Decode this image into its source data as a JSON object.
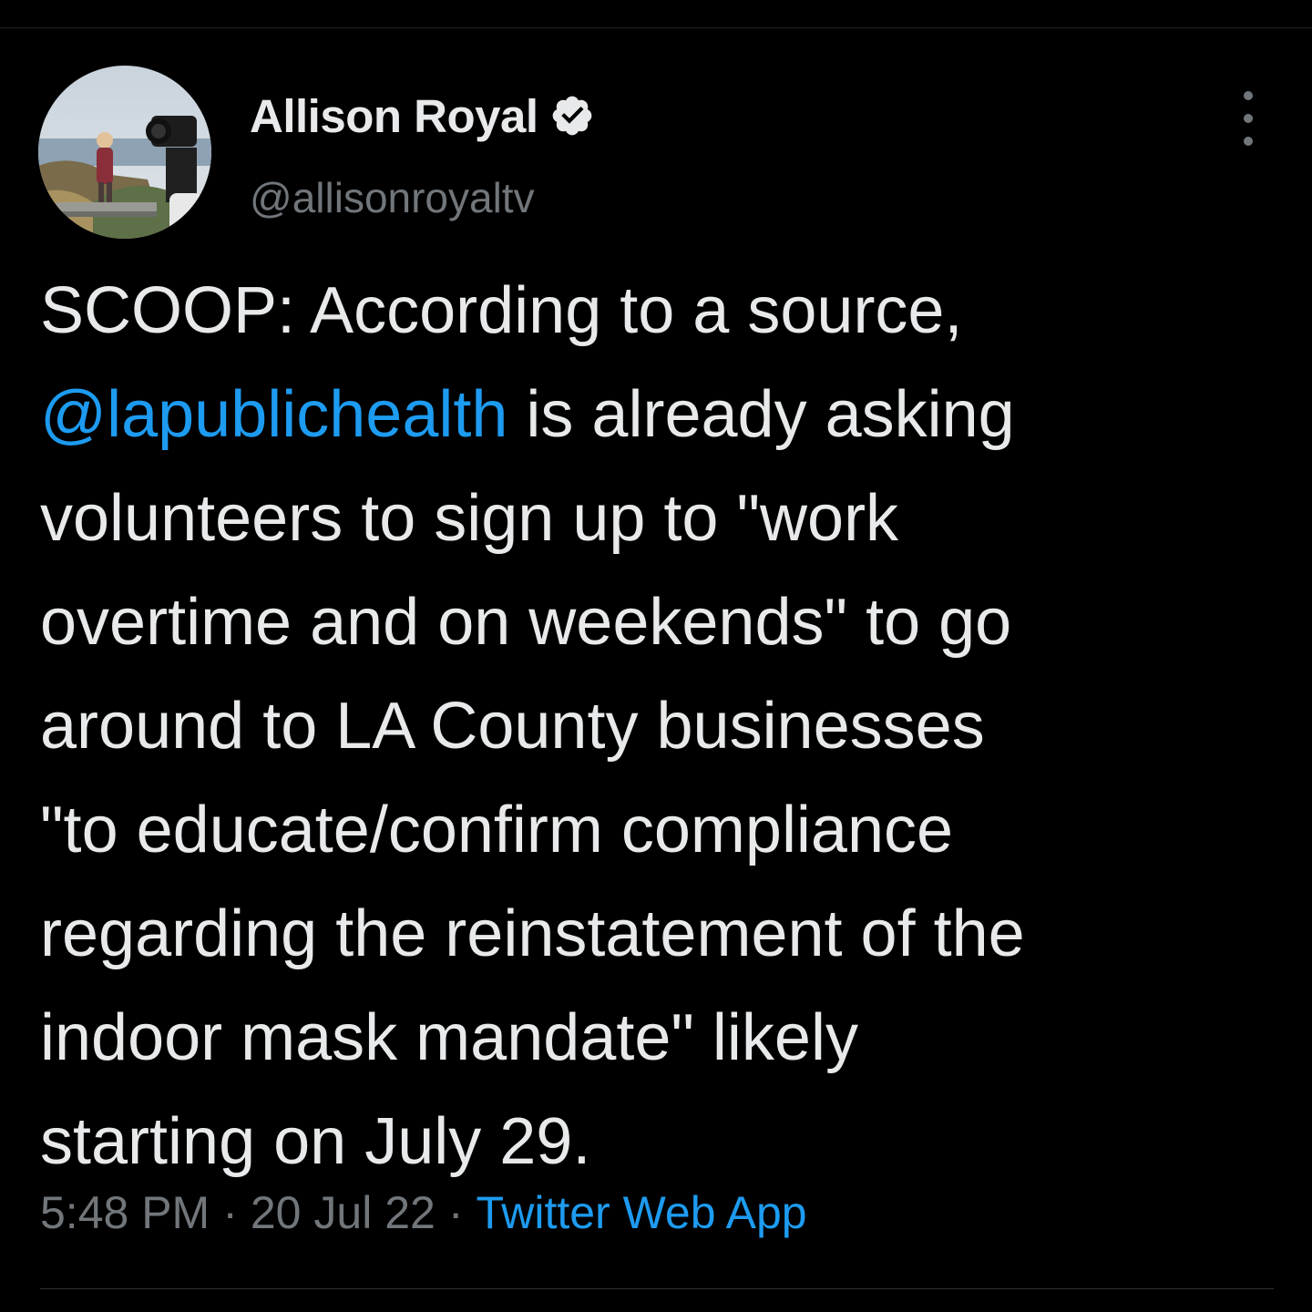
{
  "author": {
    "display_name": "Allison Royal",
    "handle": "@allisonroyaltv",
    "verified": true
  },
  "tweet": {
    "lines": [
      {
        "parts": [
          {
            "text": "SCOOP: According to a source,",
            "type": "text"
          }
        ]
      },
      {
        "parts": [
          {
            "text": "@lapublichealth",
            "type": "mention"
          },
          {
            "text": " is already asking",
            "type": "text"
          }
        ]
      },
      {
        "parts": [
          {
            "text": "volunteers to sign up to \"work",
            "type": "text"
          }
        ]
      },
      {
        "parts": [
          {
            "text": "overtime and on weekends\" to go",
            "type": "text"
          }
        ]
      },
      {
        "parts": [
          {
            "text": "around to LA County businesses",
            "type": "text"
          }
        ]
      },
      {
        "parts": [
          {
            "text": "\"to educate/confirm compliance",
            "type": "text"
          }
        ]
      },
      {
        "parts": [
          {
            "text": "regarding the reinstatement of the",
            "type": "text"
          }
        ]
      },
      {
        "parts": [
          {
            "text": "indoor mask mandate\" likely",
            "type": "text"
          }
        ]
      },
      {
        "parts": [
          {
            "text": "starting on July 29.",
            "type": "text"
          }
        ]
      }
    ]
  },
  "meta": {
    "time": "5:48 PM",
    "separator": "·",
    "date": "20 Jul 22",
    "source": "Twitter Web App"
  },
  "colors": {
    "background": "#000000",
    "text": "#e7e9ea",
    "secondary": "#71767b",
    "accent": "#1d9bf0"
  },
  "icons": {
    "verified": "verified-badge-icon",
    "more": "more-vertical-icon"
  }
}
